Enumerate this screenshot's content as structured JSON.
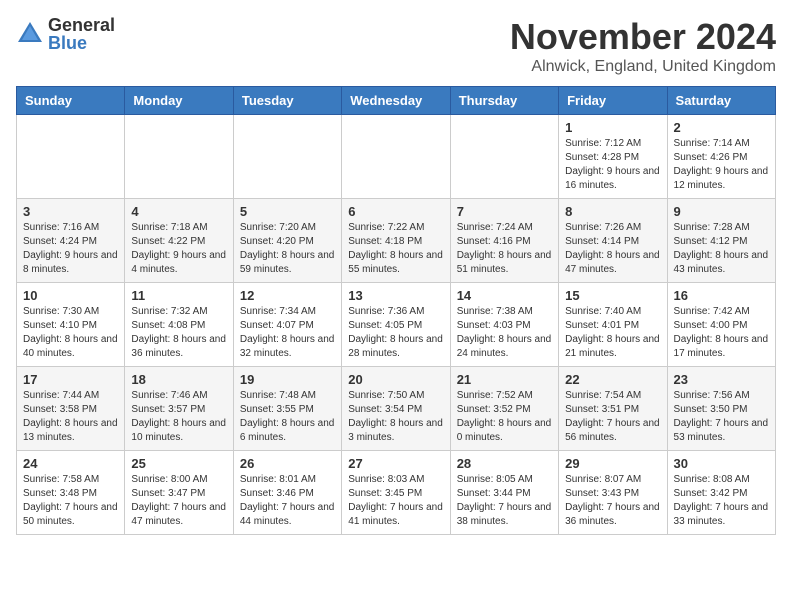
{
  "logo": {
    "general": "General",
    "blue": "Blue"
  },
  "header": {
    "month_year": "November 2024",
    "location": "Alnwick, England, United Kingdom"
  },
  "days_of_week": [
    "Sunday",
    "Monday",
    "Tuesday",
    "Wednesday",
    "Thursday",
    "Friday",
    "Saturday"
  ],
  "weeks": [
    [
      {
        "day": "",
        "info": ""
      },
      {
        "day": "",
        "info": ""
      },
      {
        "day": "",
        "info": ""
      },
      {
        "day": "",
        "info": ""
      },
      {
        "day": "",
        "info": ""
      },
      {
        "day": "1",
        "info": "Sunrise: 7:12 AM\nSunset: 4:28 PM\nDaylight: 9 hours and 16 minutes."
      },
      {
        "day": "2",
        "info": "Sunrise: 7:14 AM\nSunset: 4:26 PM\nDaylight: 9 hours and 12 minutes."
      }
    ],
    [
      {
        "day": "3",
        "info": "Sunrise: 7:16 AM\nSunset: 4:24 PM\nDaylight: 9 hours and 8 minutes."
      },
      {
        "day": "4",
        "info": "Sunrise: 7:18 AM\nSunset: 4:22 PM\nDaylight: 9 hours and 4 minutes."
      },
      {
        "day": "5",
        "info": "Sunrise: 7:20 AM\nSunset: 4:20 PM\nDaylight: 8 hours and 59 minutes."
      },
      {
        "day": "6",
        "info": "Sunrise: 7:22 AM\nSunset: 4:18 PM\nDaylight: 8 hours and 55 minutes."
      },
      {
        "day": "7",
        "info": "Sunrise: 7:24 AM\nSunset: 4:16 PM\nDaylight: 8 hours and 51 minutes."
      },
      {
        "day": "8",
        "info": "Sunrise: 7:26 AM\nSunset: 4:14 PM\nDaylight: 8 hours and 47 minutes."
      },
      {
        "day": "9",
        "info": "Sunrise: 7:28 AM\nSunset: 4:12 PM\nDaylight: 8 hours and 43 minutes."
      }
    ],
    [
      {
        "day": "10",
        "info": "Sunrise: 7:30 AM\nSunset: 4:10 PM\nDaylight: 8 hours and 40 minutes."
      },
      {
        "day": "11",
        "info": "Sunrise: 7:32 AM\nSunset: 4:08 PM\nDaylight: 8 hours and 36 minutes."
      },
      {
        "day": "12",
        "info": "Sunrise: 7:34 AM\nSunset: 4:07 PM\nDaylight: 8 hours and 32 minutes."
      },
      {
        "day": "13",
        "info": "Sunrise: 7:36 AM\nSunset: 4:05 PM\nDaylight: 8 hours and 28 minutes."
      },
      {
        "day": "14",
        "info": "Sunrise: 7:38 AM\nSunset: 4:03 PM\nDaylight: 8 hours and 24 minutes."
      },
      {
        "day": "15",
        "info": "Sunrise: 7:40 AM\nSunset: 4:01 PM\nDaylight: 8 hours and 21 minutes."
      },
      {
        "day": "16",
        "info": "Sunrise: 7:42 AM\nSunset: 4:00 PM\nDaylight: 8 hours and 17 minutes."
      }
    ],
    [
      {
        "day": "17",
        "info": "Sunrise: 7:44 AM\nSunset: 3:58 PM\nDaylight: 8 hours and 13 minutes."
      },
      {
        "day": "18",
        "info": "Sunrise: 7:46 AM\nSunset: 3:57 PM\nDaylight: 8 hours and 10 minutes."
      },
      {
        "day": "19",
        "info": "Sunrise: 7:48 AM\nSunset: 3:55 PM\nDaylight: 8 hours and 6 minutes."
      },
      {
        "day": "20",
        "info": "Sunrise: 7:50 AM\nSunset: 3:54 PM\nDaylight: 8 hours and 3 minutes."
      },
      {
        "day": "21",
        "info": "Sunrise: 7:52 AM\nSunset: 3:52 PM\nDaylight: 8 hours and 0 minutes."
      },
      {
        "day": "22",
        "info": "Sunrise: 7:54 AM\nSunset: 3:51 PM\nDaylight: 7 hours and 56 minutes."
      },
      {
        "day": "23",
        "info": "Sunrise: 7:56 AM\nSunset: 3:50 PM\nDaylight: 7 hours and 53 minutes."
      }
    ],
    [
      {
        "day": "24",
        "info": "Sunrise: 7:58 AM\nSunset: 3:48 PM\nDaylight: 7 hours and 50 minutes."
      },
      {
        "day": "25",
        "info": "Sunrise: 8:00 AM\nSunset: 3:47 PM\nDaylight: 7 hours and 47 minutes."
      },
      {
        "day": "26",
        "info": "Sunrise: 8:01 AM\nSunset: 3:46 PM\nDaylight: 7 hours and 44 minutes."
      },
      {
        "day": "27",
        "info": "Sunrise: 8:03 AM\nSunset: 3:45 PM\nDaylight: 7 hours and 41 minutes."
      },
      {
        "day": "28",
        "info": "Sunrise: 8:05 AM\nSunset: 3:44 PM\nDaylight: 7 hours and 38 minutes."
      },
      {
        "day": "29",
        "info": "Sunrise: 8:07 AM\nSunset: 3:43 PM\nDaylight: 7 hours and 36 minutes."
      },
      {
        "day": "30",
        "info": "Sunrise: 8:08 AM\nSunset: 3:42 PM\nDaylight: 7 hours and 33 minutes."
      }
    ]
  ]
}
